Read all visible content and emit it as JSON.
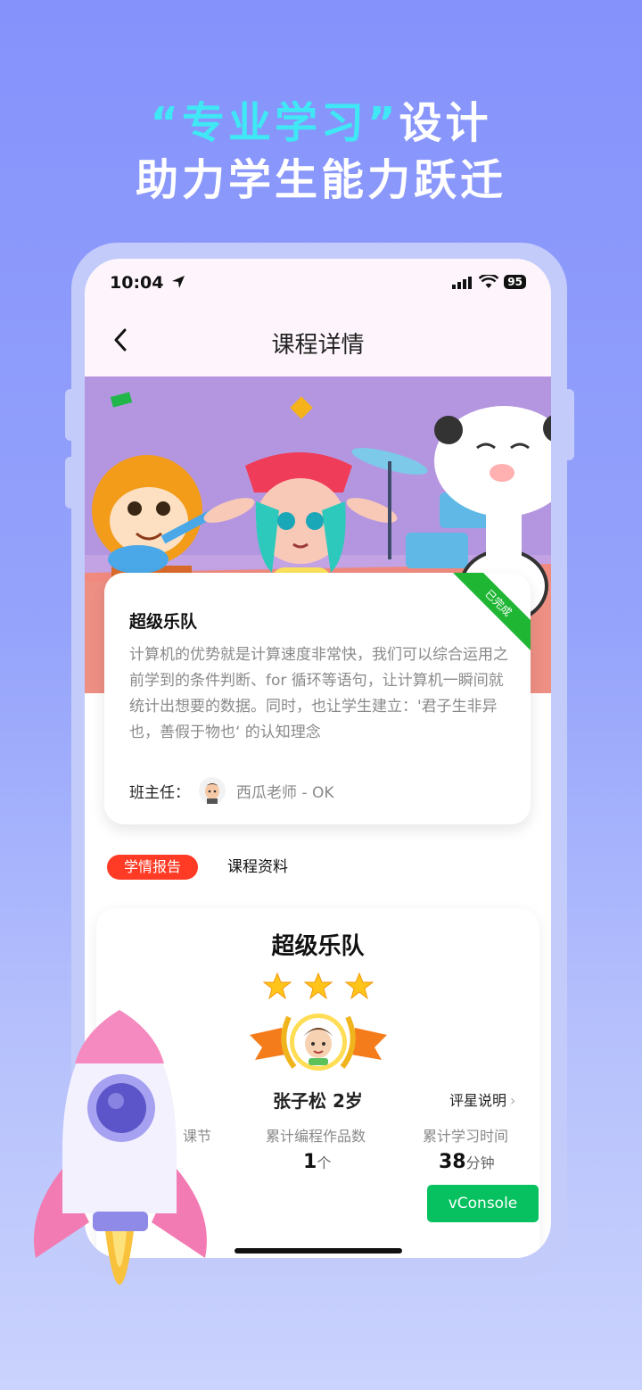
{
  "headline": {
    "line1_highlight": "“专业学习”",
    "line1_rest": "设计",
    "line2": "助力学生能力跃迁"
  },
  "status_bar": {
    "time": "10:04",
    "battery": "95"
  },
  "nav": {
    "title": "课程详情"
  },
  "course_card": {
    "title": "超级乐队",
    "description": "计算机的优势就是计算速度非常快，我们可以综合运用之前学到的条件判断、for 循环等语句，让计算机一瞬间就统计出想要的数据。同时，也让学生建立：'君子生非异也，善假于物也‘ 的认知理念",
    "teacher_label": "班主任：",
    "teacher_name": "西瓜老师 - OK",
    "status_ribbon": "已完成"
  },
  "tabs": [
    {
      "label": "学情报告",
      "active": true
    },
    {
      "label": "课程资料",
      "active": false
    }
  ],
  "report": {
    "title": "超级乐队",
    "stars": 3,
    "student": "张子松  2岁",
    "rating_link": "评星说明",
    "stats": [
      {
        "label": "课节",
        "value": "",
        "unit": ""
      },
      {
        "label": "累计编程作品数",
        "value": "1",
        "unit": "个"
      },
      {
        "label": "累计学习时间",
        "value": "38",
        "unit": "分钟"
      }
    ]
  },
  "vconsole": {
    "label": "vConsole"
  },
  "colors": {
    "accent_red": "#ff3b26",
    "completed_green": "#1fb634",
    "vconsole_green": "#07c160",
    "background": "#8592fb"
  }
}
